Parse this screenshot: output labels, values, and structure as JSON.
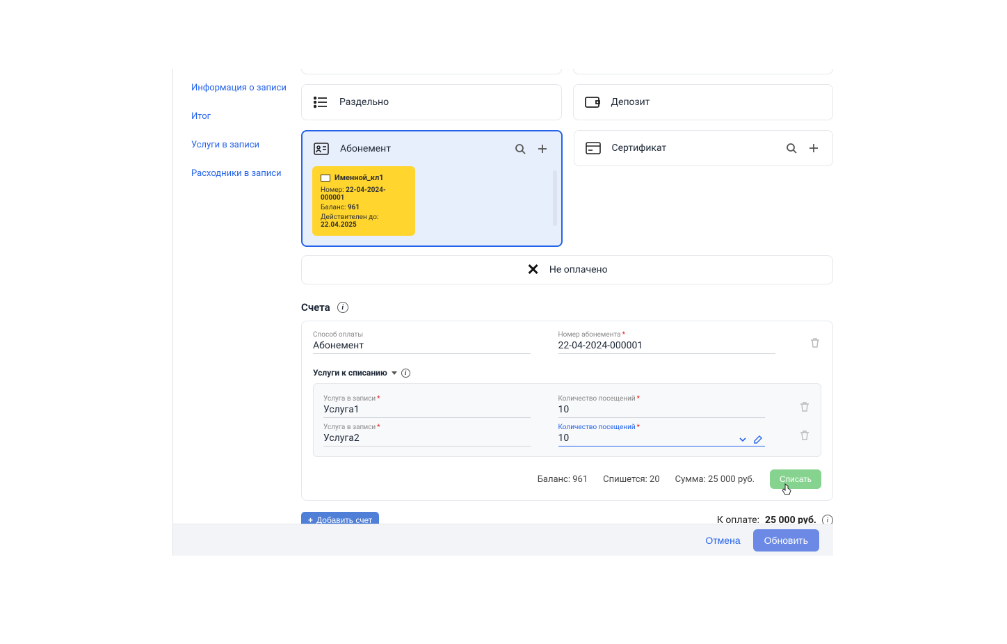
{
  "sidebar": {
    "items": [
      {
        "label": "Информация о записи",
        "active": true
      },
      {
        "label": "Итог"
      },
      {
        "label": "Услуги в записи"
      },
      {
        "label": "Расходники в записи"
      }
    ]
  },
  "paymentMethods": {
    "split": "Раздельно",
    "deposit": "Депозит",
    "subscription": "Абонемент",
    "certificate": "Сертификат"
  },
  "subcard": {
    "title": "Именной_кл1",
    "numberLabel": "Номер:",
    "number": "22-04-2024-000001",
    "balanceLabel": "Баланс:",
    "balance": "961",
    "validLabel": "Действителен до:",
    "validUntil": "22.04.2025"
  },
  "paidBar": {
    "status": "Не оплачено"
  },
  "billsTitle": "Счета",
  "bill": {
    "payMethodLabel": "Способ оплаты",
    "payMethodValue": "Абонемент",
    "subNumberLabel": "Номер абонемента",
    "subNumberValue": "22-04-2024-000001",
    "servicesLabel": "Услуги к списанию",
    "rows": [
      {
        "serviceLabel": "Услуга в записи",
        "service": "Услуга1",
        "qtyLabel": "Количество посещений",
        "qty": "10"
      },
      {
        "serviceLabel": "Услуга в записи",
        "service": "Услуга2",
        "qtyLabel": "Количество посещений",
        "qty": "10"
      }
    ],
    "summary": {
      "balance": "Баланс: 961",
      "willCharge": "Спишется: 20",
      "sum": "Сумма: 25 000 руб.",
      "chargeBtn": "Списать"
    }
  },
  "addBill": "Добавить счет",
  "toPayLabel": "К оплате:",
  "toPayValue": "25 000 руб.",
  "footer": {
    "cancel": "Отмена",
    "update": "Обновить"
  }
}
